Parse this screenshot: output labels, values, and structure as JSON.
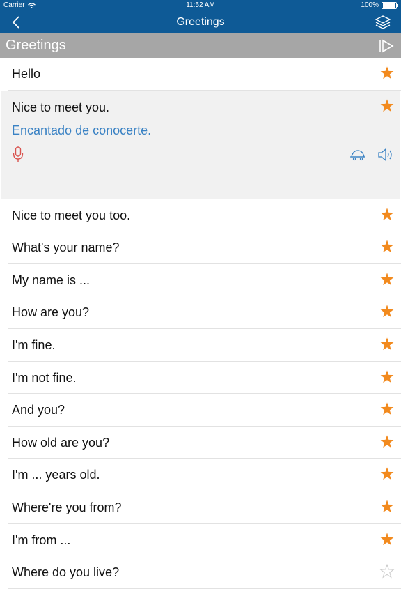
{
  "status": {
    "carrier": "Carrier",
    "time": "11:52 AM",
    "battery": "100%"
  },
  "nav": {
    "title": "Greetings"
  },
  "section": {
    "title": "Greetings"
  },
  "colors": {
    "nav_bg": "#0e5a96",
    "section_bg": "#a6a6a6",
    "star_filled": "#f28a1e",
    "star_empty": "#cccccc",
    "translation": "#3a82c4",
    "mic": "#d9534f"
  },
  "phrases": [
    {
      "text": "Hello",
      "starred": true
    },
    {
      "text": "Nice to meet you.",
      "starred": true,
      "translation": "Encantado de conocerte.",
      "expanded": true
    },
    {
      "text": "Nice to meet you too.",
      "starred": true
    },
    {
      "text": "What's your name?",
      "starred": true
    },
    {
      "text": "My name is ...",
      "starred": true
    },
    {
      "text": "How are you?",
      "starred": true
    },
    {
      "text": "I'm fine.",
      "starred": true
    },
    {
      "text": "I'm not fine.",
      "starred": true
    },
    {
      "text": "And you?",
      "starred": true
    },
    {
      "text": "How old are you?",
      "starred": true
    },
    {
      "text": "I'm ... years old.",
      "starred": true
    },
    {
      "text": "Where're you from?",
      "starred": true
    },
    {
      "text": "I'm from ...",
      "starred": true
    },
    {
      "text": "Where do you live?",
      "starred": false
    }
  ]
}
